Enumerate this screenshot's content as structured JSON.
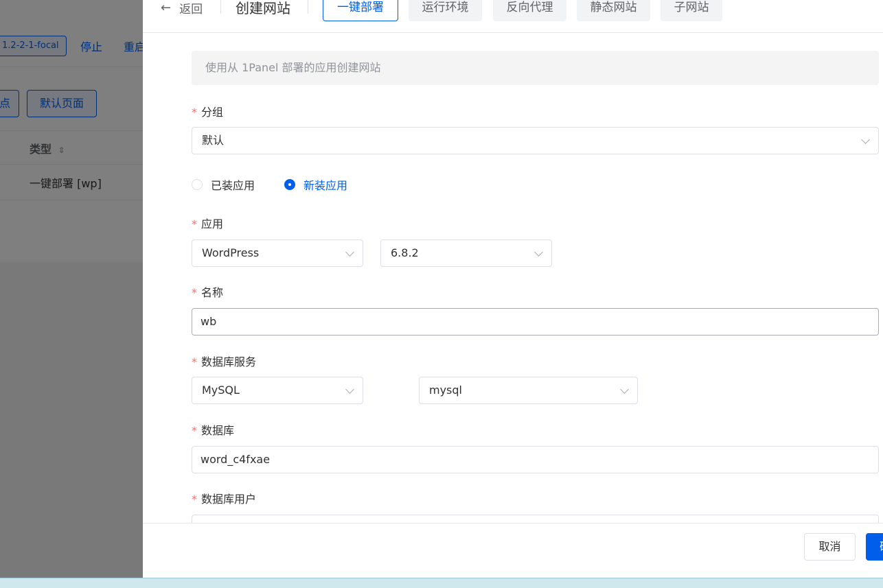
{
  "background": {
    "tag_text": "1.2-2-1-focal",
    "link_stop": "停止",
    "link_restart": "重启",
    "btn_partial": "点",
    "btn_default_page": "默认页面",
    "col_type": "类型",
    "sort_icon": "sort-icon",
    "row_type_value": "一键部署 [wp]"
  },
  "header": {
    "back_label": "返回",
    "title": "创建网站",
    "tabs": [
      {
        "label": "一键部署",
        "active": true
      },
      {
        "label": "运行环境",
        "active": false
      },
      {
        "label": "反向代理",
        "active": false
      },
      {
        "label": "静态网站",
        "active": false
      },
      {
        "label": "子网站",
        "active": false
      }
    ]
  },
  "form": {
    "info": "使用从 1Panel 部署的应用创建网站",
    "group_label": "分组",
    "group_value": "默认",
    "radio_installed": "已装应用",
    "radio_new": "新装应用",
    "app_label": "应用",
    "app_value": "WordPress",
    "version_value": "6.8.2",
    "name_label": "名称",
    "name_value": "wb",
    "db_service_label": "数据库服务",
    "db_type_value": "MySQL",
    "db_instance_value": "mysql",
    "db_label": "数据库",
    "db_value": "word_c4fxae",
    "db_user_label": "数据库用户",
    "required_mark": "*"
  },
  "footer": {
    "cancel_label": "取消",
    "confirm_label": "确认"
  },
  "colors": {
    "primary": "#005eeb",
    "required": "#f56c6c"
  }
}
